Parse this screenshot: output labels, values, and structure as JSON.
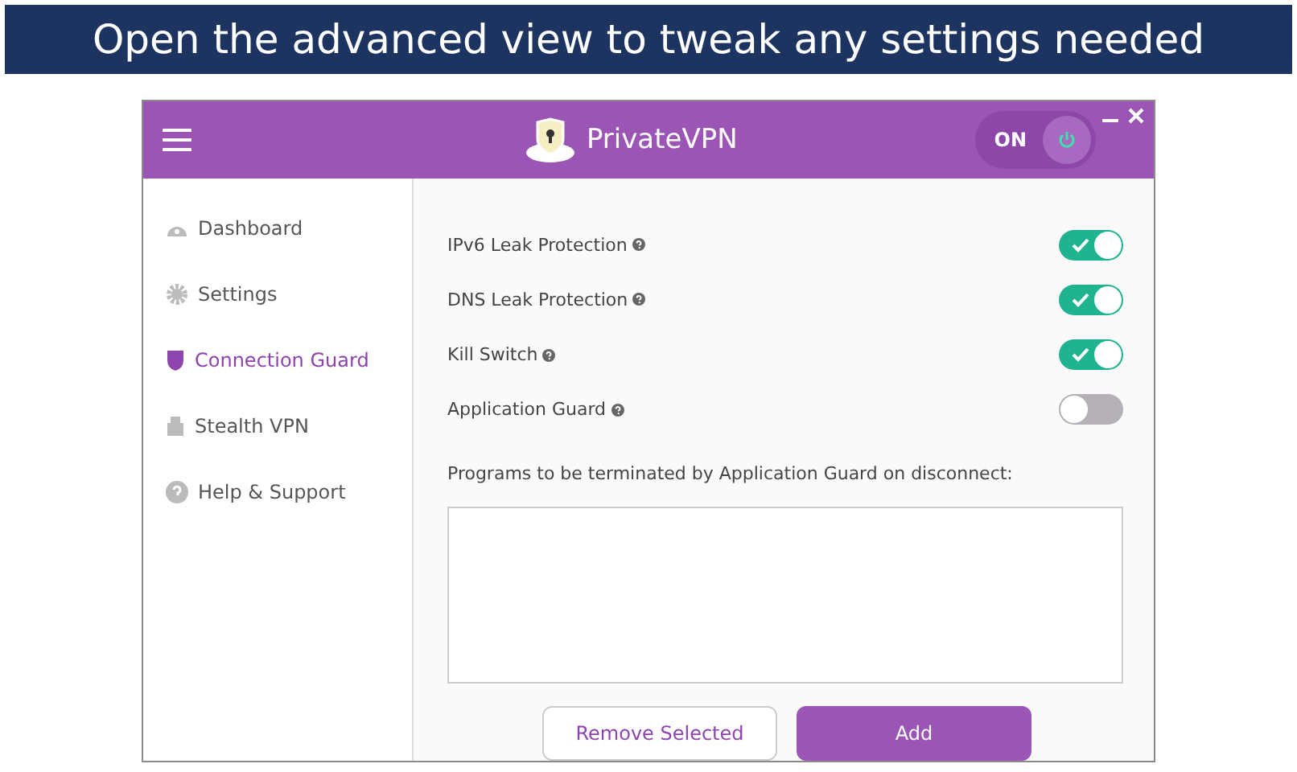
{
  "caption": "Open the advanced view to tweak any settings needed",
  "header": {
    "brand": "PrivateVPN",
    "power": {
      "label": "ON",
      "on": true
    }
  },
  "sidebar": {
    "items": [
      {
        "label": "Dashboard",
        "selected": false
      },
      {
        "label": "Settings",
        "selected": false
      },
      {
        "label": "Connection Guard",
        "selected": true
      },
      {
        "label": "Stealth VPN",
        "selected": false
      },
      {
        "label": "Help & Support",
        "selected": false
      }
    ]
  },
  "settings": [
    {
      "label": "IPv6 Leak Protection",
      "on": true
    },
    {
      "label": "DNS Leak Protection",
      "on": true
    },
    {
      "label": "Kill Switch",
      "on": true
    },
    {
      "label": "Application Guard",
      "on": false
    }
  ],
  "programs": {
    "label": "Programs to be terminated by Application Guard on disconnect:"
  },
  "buttons": [
    {
      "label": "Remove Selected",
      "kind": "outline"
    },
    {
      "label": "Add",
      "kind": "primary"
    }
  ]
}
